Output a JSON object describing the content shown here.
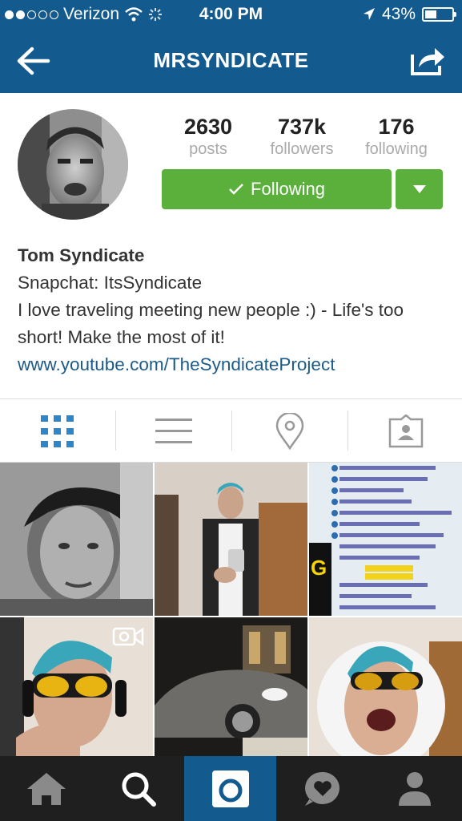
{
  "status_bar": {
    "carrier": "Verizon",
    "time": "4:00 PM",
    "battery_label": "43%",
    "battery_level": 0.43
  },
  "nav": {
    "title": "MRSYNDICATE"
  },
  "profile": {
    "stats": [
      {
        "value": "2630",
        "label": "posts"
      },
      {
        "value": "737k",
        "label": "followers"
      },
      {
        "value": "176",
        "label": "following"
      }
    ],
    "follow_button": "Following",
    "name": "Tom Syndicate",
    "bio_line1": "Snapchat: ItsSyndicate",
    "bio_line2": "I love traveling meeting new people :) - Life's too short! Make the most of it!",
    "website": "www.youtube.com/TheSyndicateProject"
  },
  "view_tabs": [
    {
      "icon": "grid-icon",
      "active": true
    },
    {
      "icon": "list-icon",
      "active": false
    },
    {
      "icon": "location-pin-icon",
      "active": false
    },
    {
      "icon": "tagged-photos-icon",
      "active": false
    }
  ],
  "posts": [
    {
      "kind": "photo",
      "desc_icon": "portrait-photo"
    },
    {
      "kind": "photo",
      "desc_icon": "mirror-selfie-photo"
    },
    {
      "kind": "photo",
      "desc_icon": "screen-chat-photo"
    },
    {
      "kind": "video",
      "desc_icon": "headphones-selfie-video"
    },
    {
      "kind": "photo",
      "desc_icon": "car-night-photo"
    },
    {
      "kind": "photo",
      "desc_icon": "hood-selfie-photo"
    }
  ],
  "colors": {
    "brand_blue": "#135a8e",
    "follow_green": "#5bb03c",
    "link_blue": "#1c5a88",
    "tabbar_dark": "#1f1f1f"
  },
  "bottom_tabs": [
    {
      "icon": "home-icon",
      "active": false
    },
    {
      "icon": "search-icon",
      "active": false
    },
    {
      "icon": "camera-icon",
      "active": true
    },
    {
      "icon": "activity-heart-icon",
      "active": false
    },
    {
      "icon": "profile-icon",
      "active": false
    }
  ]
}
